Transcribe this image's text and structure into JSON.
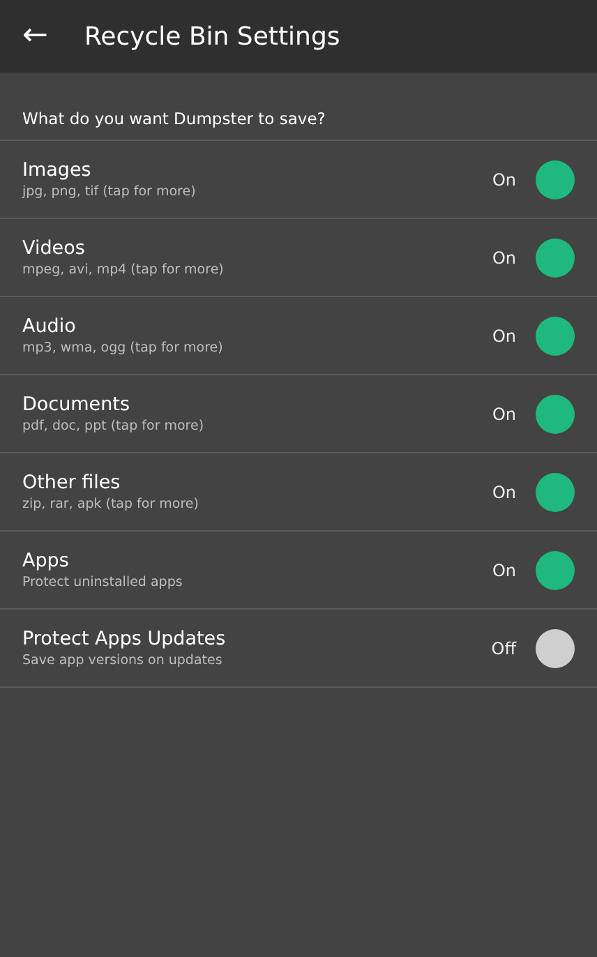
{
  "header": {
    "back_icon": "←",
    "title": "Recycle Bin Settings"
  },
  "section_label": "What do you want Dumpster to save?",
  "settings": [
    {
      "title": "Images",
      "subtitle": "jpg, png, tif (tap for more)",
      "state_label": "On",
      "on": true
    },
    {
      "title": "Videos",
      "subtitle": "mpeg, avi, mp4 (tap for more)",
      "state_label": "On",
      "on": true
    },
    {
      "title": "Audio",
      "subtitle": "mp3, wma, ogg (tap for more)",
      "state_label": "On",
      "on": true
    },
    {
      "title": "Documents",
      "subtitle": "pdf, doc, ppt (tap for more)",
      "state_label": "On",
      "on": true
    },
    {
      "title": "Other files",
      "subtitle": "zip, rar, apk (tap for more)",
      "state_label": "On",
      "on": true
    },
    {
      "title": "Apps",
      "subtitle": "Protect uninstalled apps",
      "state_label": "On",
      "on": true
    },
    {
      "title": "Protect Apps Updates",
      "subtitle": "Save app versions on updates",
      "state_label": "Off",
      "on": false
    }
  ]
}
